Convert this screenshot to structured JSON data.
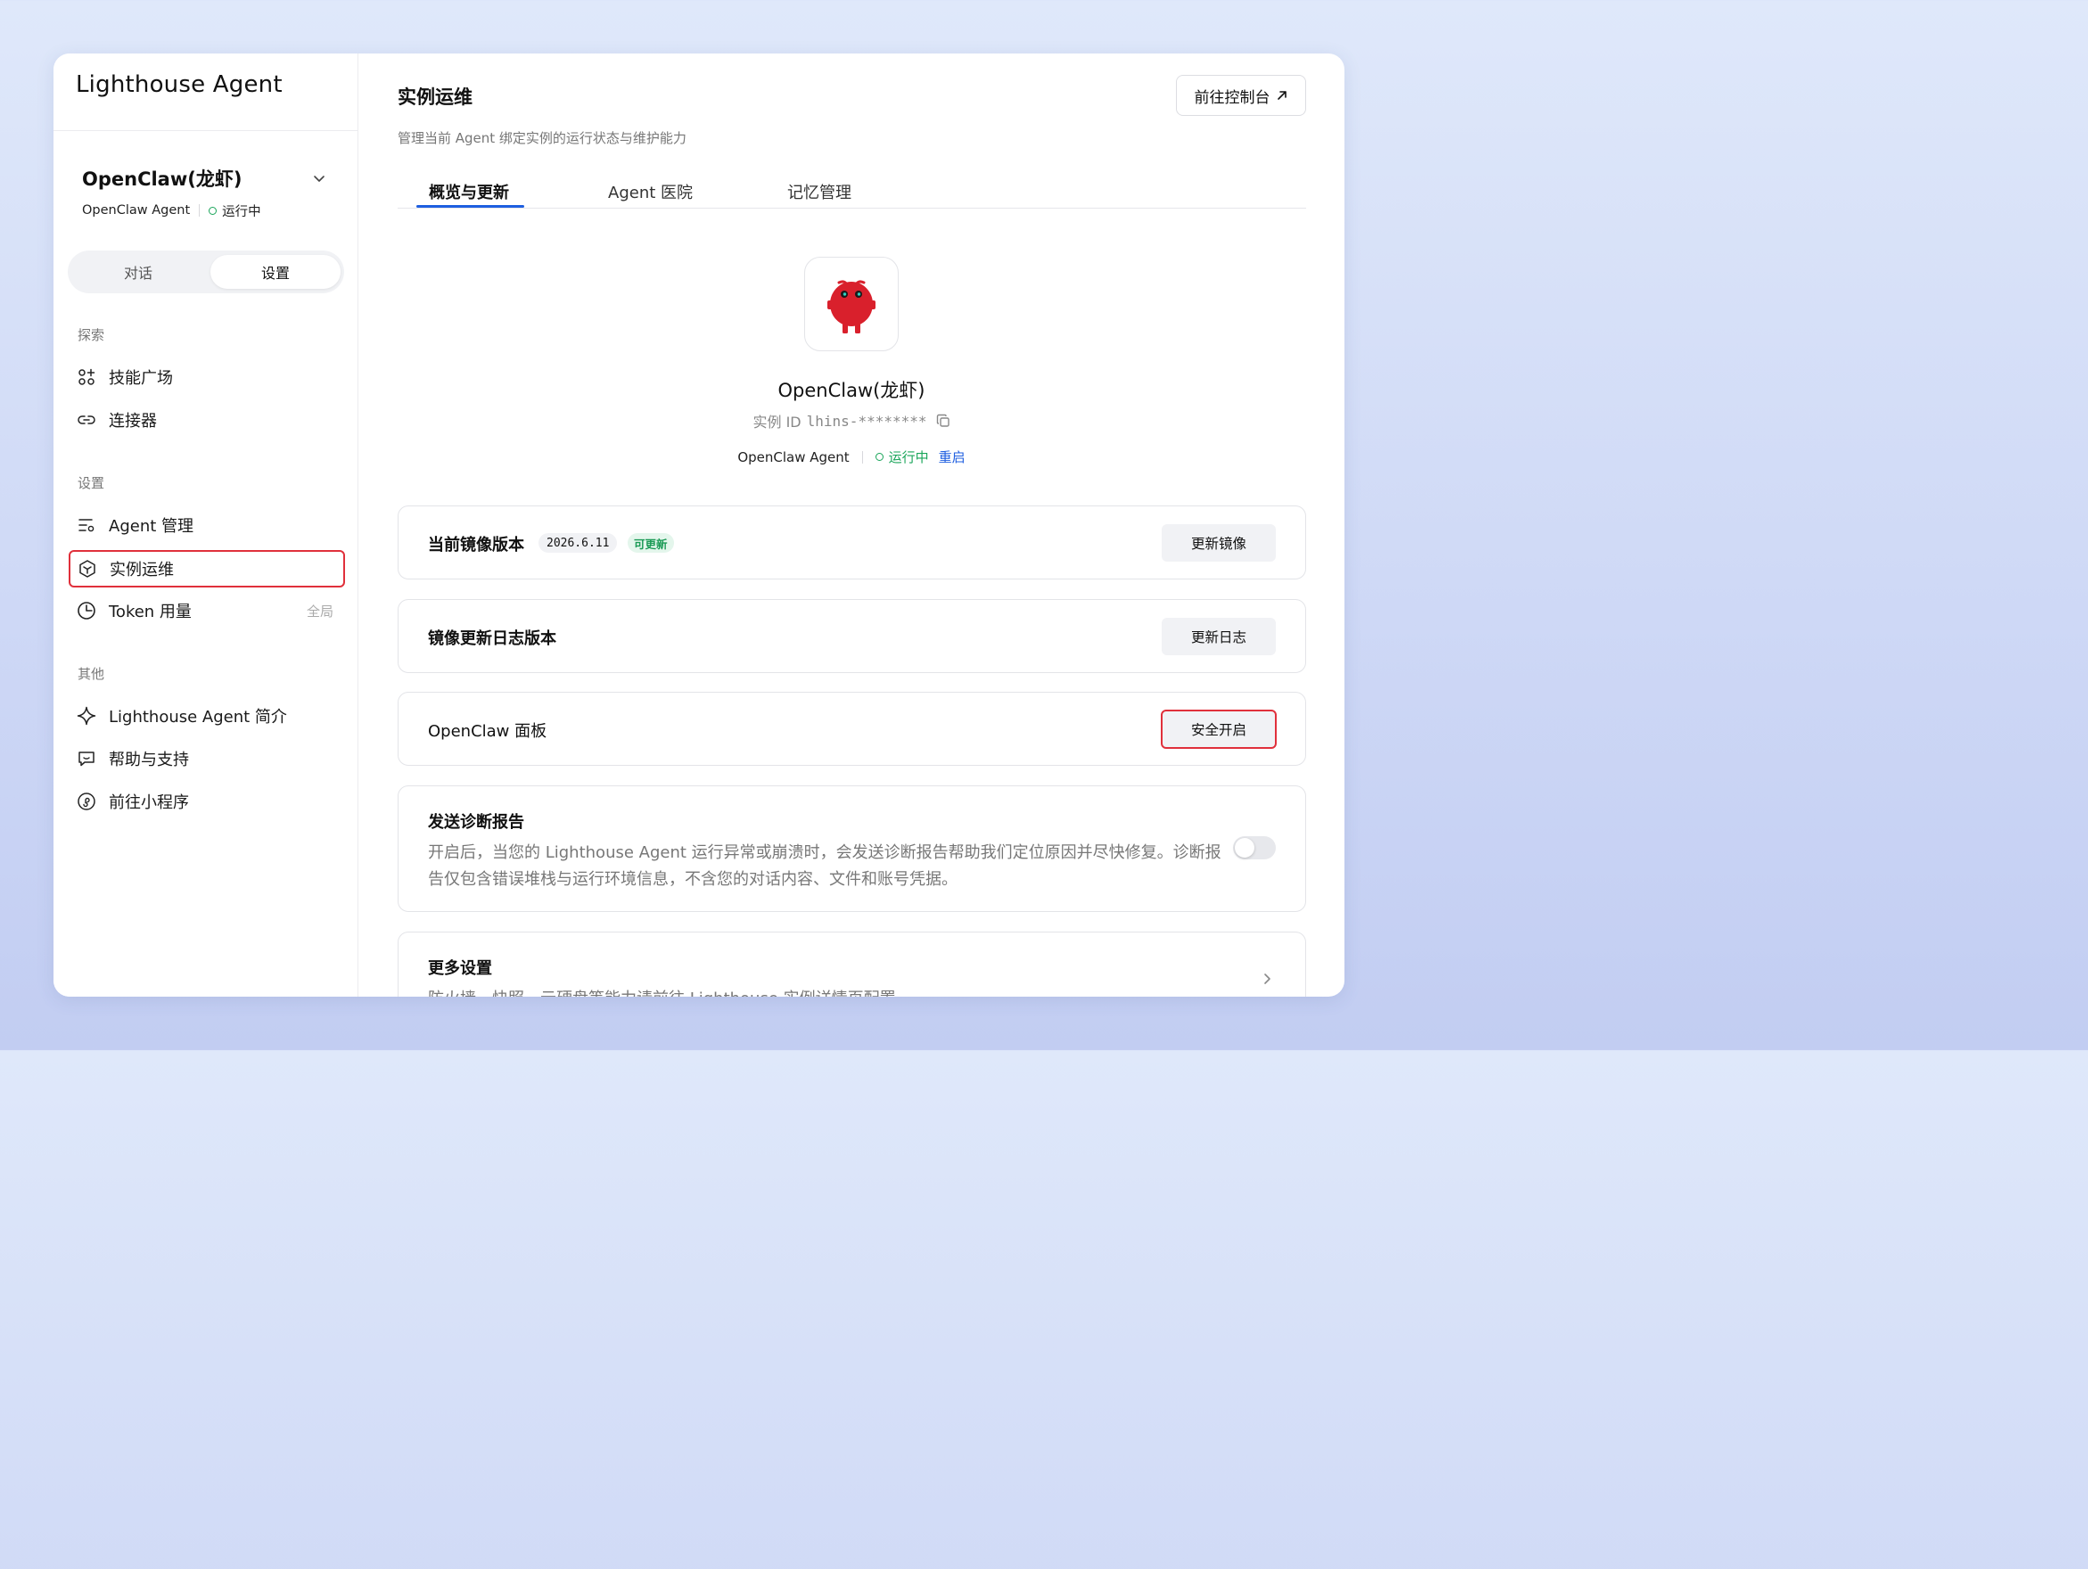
{
  "sidebar": {
    "brand": "Lighthouse Agent",
    "agent": {
      "name": "OpenClaw(龙虾)",
      "type": "OpenClaw Agent",
      "status": "运行中"
    },
    "segment": {
      "left": "对话",
      "right": "设置"
    },
    "sections": {
      "explore": "探索",
      "settings": "设置",
      "other": "其他"
    },
    "items": {
      "skills": "技能广场",
      "connectors": "连接器",
      "agent_manage": "Agent 管理",
      "instance_ops": "实例运维",
      "token_usage": "Token 用量",
      "token_scope": "全局",
      "about": "Lighthouse Agent 简介",
      "help": "帮助与支持",
      "miniprogram": "前往小程序"
    }
  },
  "main": {
    "title": "实例运维",
    "subtitle": "管理当前 Agent 绑定实例的运行状态与维护能力",
    "console_button": "前往控制台",
    "tabs": [
      "概览与更新",
      "Agent 医院",
      "记忆管理"
    ],
    "hero": {
      "name": "OpenClaw(龙虾)",
      "id_label": "实例 ID",
      "id_value": "lhins-********",
      "type": "OpenClaw Agent",
      "status": "运行中",
      "restart": "重启"
    },
    "cards": {
      "image_version": {
        "title": "当前镜像版本",
        "version": "2026.6.11",
        "badge": "可更新",
        "button": "更新镜像"
      },
      "changelog": {
        "title": "镜像更新日志版本",
        "button": "更新日志"
      },
      "panel": {
        "title": "OpenClaw 面板",
        "button": "安全开启"
      },
      "diagnostics": {
        "title": "发送诊断报告",
        "description": "开启后，当您的 Lighthouse Agent 运行异常或崩溃时，会发送诊断报告帮助我们定位原因并尽快修复。诊断报告仅包含错误堆栈与运行环境信息，不含您的对话内容、文件和账号凭据。",
        "enabled": false
      },
      "more": {
        "title": "更多设置",
        "description": "防火墙、快照、云硬盘等能力请前往 Lighthouse 实例详情页配置"
      }
    }
  },
  "colors": {
    "accent": "#1f5fe0",
    "running": "#1aa55a",
    "highlight": "#e0303b",
    "mascot": "#d9202c"
  },
  "icons": [
    "chevron-down-icon",
    "skills-grid-icon",
    "link-icon",
    "list-settings-icon",
    "cube-icon",
    "pie-chart-icon",
    "sparkle-icon",
    "chat-bubble-icon",
    "miniprogram-icon",
    "external-arrow-icon",
    "copy-icon",
    "chevron-right-icon"
  ]
}
